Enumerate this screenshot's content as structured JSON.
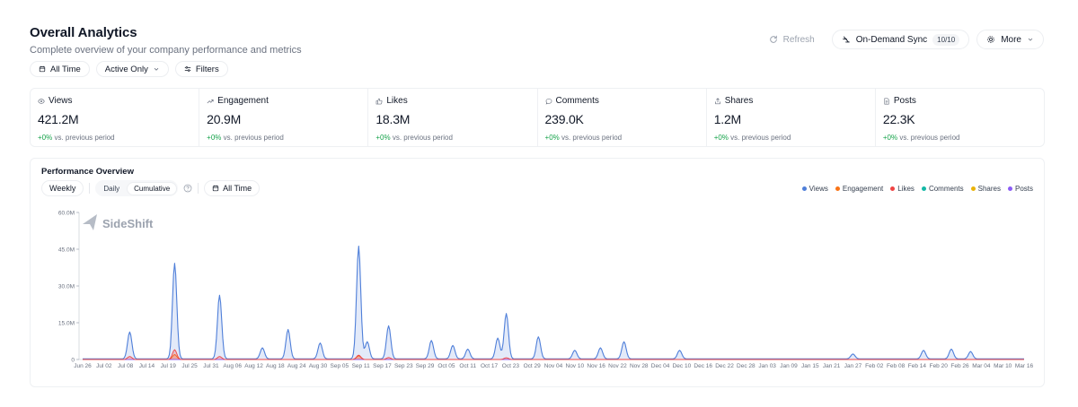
{
  "header": {
    "title": "Overall Analytics",
    "subtitle": "Complete overview of your company performance and metrics"
  },
  "actions": {
    "refresh_label": "Refresh",
    "sync_label": "On-Demand Sync",
    "sync_badge": "10/10",
    "more_label": "More"
  },
  "filters": {
    "time_label": "All Time",
    "status_label": "Active Only",
    "filters_label": "Filters"
  },
  "stats": [
    {
      "label": "Views",
      "value": "421.2M",
      "change": "+0%",
      "change_text": "vs. previous period",
      "icon": "eye-icon"
    },
    {
      "label": "Engagement",
      "value": "20.9M",
      "change": "+0%",
      "change_text": "vs. previous period",
      "icon": "trend-icon"
    },
    {
      "label": "Likes",
      "value": "18.3M",
      "change": "+0%",
      "change_text": "vs. previous period",
      "icon": "thumbs-up-icon"
    },
    {
      "label": "Comments",
      "value": "239.0K",
      "change": "+0%",
      "change_text": "vs. previous period",
      "icon": "comment-icon"
    },
    {
      "label": "Shares",
      "value": "1.2M",
      "change": "+0%",
      "change_text": "vs. previous period",
      "icon": "share-icon"
    },
    {
      "label": "Posts",
      "value": "22.3K",
      "change": "+0%",
      "change_text": "vs. previous period",
      "icon": "document-icon"
    }
  ],
  "performance": {
    "title": "Performance Overview",
    "period_label": "Weekly",
    "mode_daily": "Daily",
    "mode_cumulative": "Cumulative",
    "time_label": "All Time",
    "watermark": "SideShift"
  },
  "colors": {
    "views": "#4f7fd9",
    "engagement": "#f97316",
    "likes": "#ef4444",
    "comments": "#14b8a6",
    "shares": "#eab308",
    "posts": "#8b5cf6",
    "positive": "#16a34a"
  },
  "chart_data": {
    "type": "area",
    "legend_position": "top-right",
    "ylim": [
      0,
      60000000
    ],
    "y_ticks": [
      0,
      15000000,
      30000000,
      45000000,
      60000000
    ],
    "y_tick_labels": [
      "0",
      "15.0M",
      "30.0M",
      "45.0M",
      "60.0M"
    ],
    "x_tick_labels": [
      "Jun 26",
      "Jul 02",
      "Jul 08",
      "Jul 14",
      "Jul 19",
      "Jul 25",
      "Jul 31",
      "Aug 06",
      "Aug 12",
      "Aug 18",
      "Aug 24",
      "Aug 30",
      "Sep 05",
      "Sep 11",
      "Sep 17",
      "Sep 23",
      "Sep 29",
      "Oct 05",
      "Oct 11",
      "Oct 17",
      "Oct 23",
      "Oct 29",
      "Nov 04",
      "Nov 10",
      "Nov 16",
      "Nov 22",
      "Nov 28",
      "Dec 04",
      "Dec 10",
      "Dec 16",
      "Dec 22",
      "Dec 28",
      "Jan 03",
      "Jan 09",
      "Jan 15",
      "Jan 21",
      "Jan 27",
      "Feb 02",
      "Feb 08",
      "Feb 14",
      "Feb 20",
      "Feb 26",
      "Mar 04",
      "Mar 10",
      "Mar 16"
    ],
    "series": [
      {
        "name": "Views",
        "color": "#4f7fd9",
        "peaks": [
          {
            "x": 2.2,
            "y": 11000000
          },
          {
            "x": 4.3,
            "y": 39000000
          },
          {
            "x": 6.4,
            "y": 26000000
          },
          {
            "x": 8.4,
            "y": 4500000
          },
          {
            "x": 9.6,
            "y": 12000000
          },
          {
            "x": 11.1,
            "y": 6500000
          },
          {
            "x": 12.9,
            "y": 46000000
          },
          {
            "x": 13.3,
            "y": 7000000
          },
          {
            "x": 14.3,
            "y": 13500000
          },
          {
            "x": 16.3,
            "y": 7500000
          },
          {
            "x": 17.3,
            "y": 5500000
          },
          {
            "x": 18.0,
            "y": 4000000
          },
          {
            "x": 19.4,
            "y": 8500000
          },
          {
            "x": 19.8,
            "y": 18500000
          },
          {
            "x": 21.3,
            "y": 9000000
          },
          {
            "x": 23.0,
            "y": 3500000
          },
          {
            "x": 24.2,
            "y": 4500000
          },
          {
            "x": 25.3,
            "y": 7000000
          },
          {
            "x": 27.9,
            "y": 3500000
          },
          {
            "x": 36.0,
            "y": 2000000
          },
          {
            "x": 39.3,
            "y": 3500000
          },
          {
            "x": 40.6,
            "y": 4000000
          },
          {
            "x": 41.5,
            "y": 3000000
          }
        ]
      },
      {
        "name": "Engagement",
        "color": "#f97316",
        "peaks": [
          {
            "x": 4.3,
            "y": 2000000
          },
          {
            "x": 12.9,
            "y": 1500000
          }
        ]
      },
      {
        "name": "Likes",
        "color": "#ef4444",
        "peaks": [
          {
            "x": 2.2,
            "y": 1200000
          },
          {
            "x": 4.3,
            "y": 4000000
          },
          {
            "x": 6.4,
            "y": 1200000
          },
          {
            "x": 12.9,
            "y": 1800000
          },
          {
            "x": 14.3,
            "y": 800000
          },
          {
            "x": 19.8,
            "y": 700000
          }
        ]
      },
      {
        "name": "Comments",
        "color": "#14b8a6",
        "peaks": []
      },
      {
        "name": "Shares",
        "color": "#eab308",
        "peaks": []
      },
      {
        "name": "Posts",
        "color": "#8b5cf6",
        "peaks": []
      }
    ]
  }
}
